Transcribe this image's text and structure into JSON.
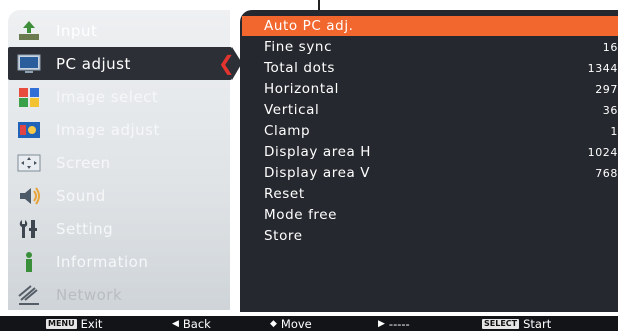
{
  "menu": {
    "items": [
      {
        "label": "Input",
        "icon": "input-icon",
        "state": "normal"
      },
      {
        "label": "PC adjust",
        "icon": "pc-adjust-icon",
        "state": "active"
      },
      {
        "label": "Image select",
        "icon": "image-select-icon",
        "state": "normal"
      },
      {
        "label": "Image adjust",
        "icon": "image-adjust-icon",
        "state": "normal"
      },
      {
        "label": "Screen",
        "icon": "screen-icon",
        "state": "normal"
      },
      {
        "label": "Sound",
        "icon": "sound-icon",
        "state": "normal"
      },
      {
        "label": "Setting",
        "icon": "setting-icon",
        "state": "normal"
      },
      {
        "label": "Information",
        "icon": "information-icon",
        "state": "normal"
      },
      {
        "label": "Network",
        "icon": "network-icon",
        "state": "disabled"
      }
    ]
  },
  "panel": {
    "rows": [
      {
        "label": "Auto PC adj.",
        "value": "",
        "selected": true
      },
      {
        "label": "Fine sync",
        "value": "16"
      },
      {
        "label": "Total dots",
        "value": "1344"
      },
      {
        "label": "Horizontal",
        "value": "297"
      },
      {
        "label": "Vertical",
        "value": "36"
      },
      {
        "label": "Clamp",
        "value": "1"
      },
      {
        "label": "Display area H",
        "value": "1024"
      },
      {
        "label": "Display area V",
        "value": "768"
      },
      {
        "label": "Reset",
        "value": ""
      },
      {
        "label": "Mode free",
        "value": ""
      },
      {
        "label": "Store",
        "value": ""
      }
    ]
  },
  "footer": {
    "exit_key": "MENU",
    "exit_label": "Exit",
    "back_glyph": "◀",
    "back_label": "Back",
    "move_glyph": "◆",
    "move_label": "Move",
    "next_glyph": "▶",
    "next_label": "-----",
    "start_key": "SELECT",
    "start_label": "Start"
  },
  "colors": {
    "accent": "#f2672e",
    "panel_bg": "#25282e",
    "active_bg": "#2c2f36",
    "chevron": "#e3342f"
  }
}
